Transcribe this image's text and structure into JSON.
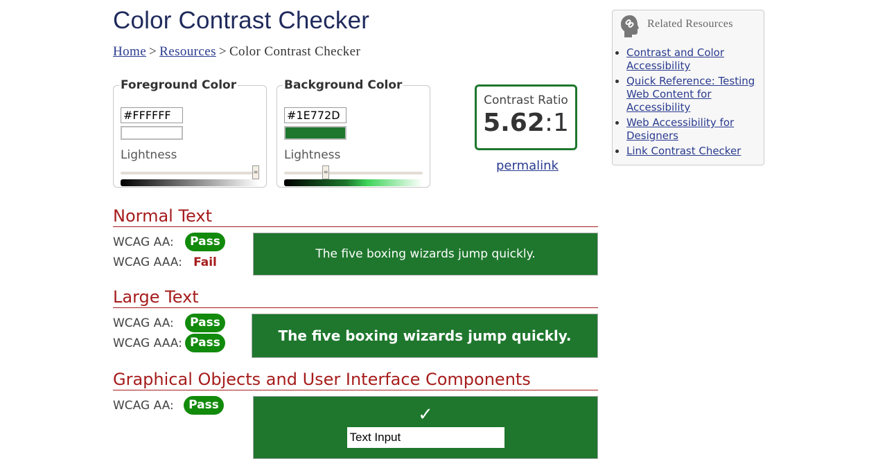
{
  "header": {
    "title": "Color Contrast Checker"
  },
  "breadcrumb": {
    "items": [
      "Home",
      "Resources",
      "Color Contrast Checker"
    ],
    "separator": ">"
  },
  "foreground": {
    "legend": "Foreground Color",
    "hex_value": "#FFFFFF",
    "lightness_label": "Lightness",
    "lightness_percent": 100,
    "color": "#FFFFFF"
  },
  "background": {
    "legend": "Background Color",
    "hex_value": "#1E772D",
    "lightness_label": "Lightness",
    "lightness_percent": 29,
    "color": "#1E772D"
  },
  "contrast": {
    "label": "Contrast Ratio",
    "value": "5.62",
    "suffix": ":1",
    "permalink": "permalink"
  },
  "normal_text": {
    "heading": "Normal Text",
    "aa_label": "WCAG AA:",
    "aa_result": "Pass",
    "aaa_label": "WCAG AAA:",
    "aaa_result": "Fail",
    "sample": "The five boxing wizards jump quickly."
  },
  "large_text": {
    "heading": "Large Text",
    "aa_label": "WCAG AA:",
    "aa_result": "Pass",
    "aaa_label": "WCAG AAA:",
    "aaa_result": "Pass",
    "sample": "The five boxing wizards jump quickly."
  },
  "graphical": {
    "heading": "Graphical Objects and User Interface Components",
    "aa_label": "WCAG AA:",
    "aa_result": "Pass",
    "check_icon": "✓",
    "text_input_value": "Text Input"
  },
  "related": {
    "title": "Related Resources",
    "icon": "link-head-icon",
    "links": [
      "Contrast and Color Accessibility",
      "Quick Reference: Testing Web Content for Accessibility",
      "Web Accessibility for Designers",
      "Link Contrast Checker"
    ]
  },
  "colors": {
    "title": "#1F2A5C",
    "link": "#2A3B8F",
    "heading_red": "#A61C1C",
    "pass_green": "#128A0C",
    "sample_bg": "#1E772D"
  }
}
